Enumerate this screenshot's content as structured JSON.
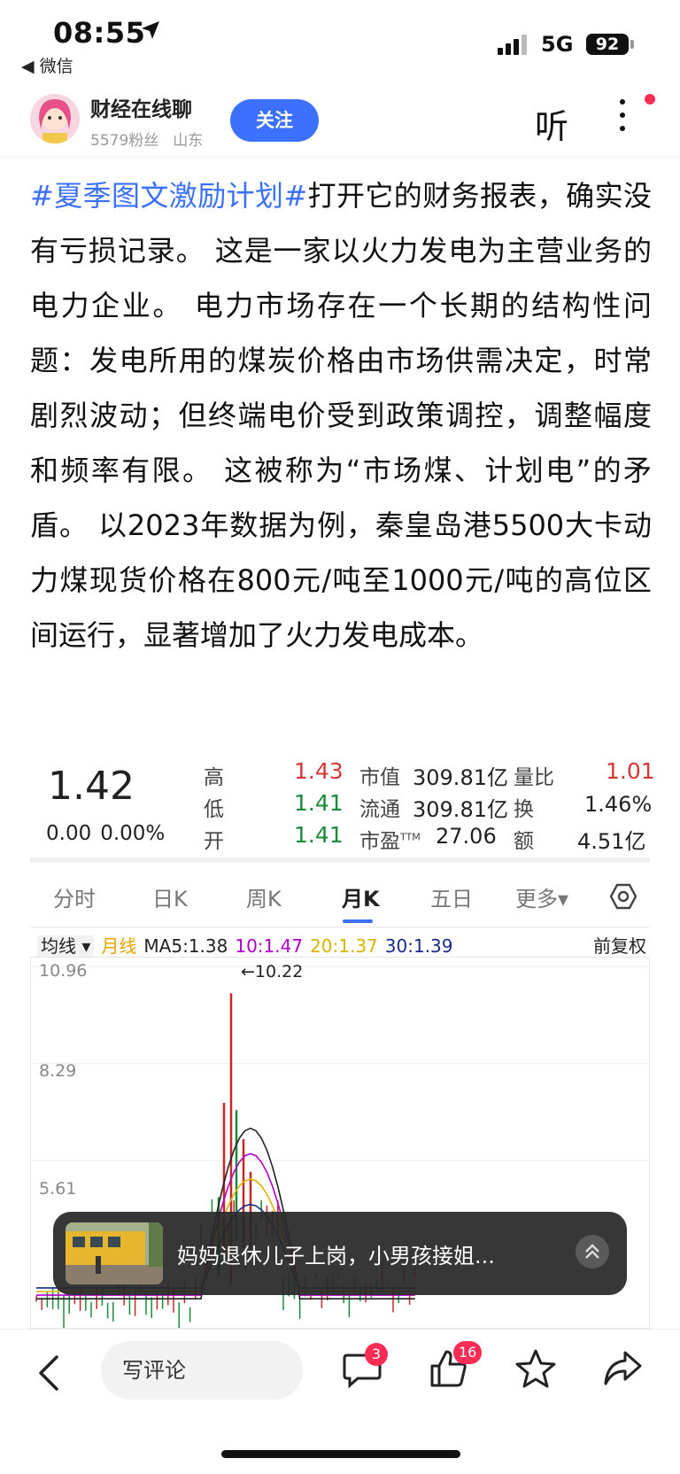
{
  "status_bar": {
    "time": "08:55",
    "back_app": "◀ 微信",
    "network": "5G",
    "battery": "92"
  },
  "author": {
    "name": "财经在线聊",
    "followers": "5579粉丝",
    "location": "山东",
    "follow_label": "关注",
    "listen_label": "听"
  },
  "article": {
    "hashtag": "#夏季图文激励计划#",
    "body": "打开它的财务报表，确实没有亏损记录。 这是一家以火力发电为主营业务的电力企业。 电力市场存在一个长期的结构性问题：发电所用的煤炭价格由市场供需决定，时常剧烈波动；但终端电价受到政策调控，调整幅度和频率有限。 这被称为“市场煤、计划电”的矛盾。 以2023年数据为例，秦皇岛港5500大卡动力煤现货价格在800元/吨至1000元/吨的高位区间运行，显著增加了火力发电成本。"
  },
  "quote": {
    "price": "1.42",
    "change": "0.00",
    "change_pct": "0.00%",
    "high_label": "高",
    "high": "1.43",
    "low_label": "低",
    "low": "1.41",
    "open_label": "开",
    "open": "1.41",
    "mktcap_label": "市值",
    "mktcap": "309.81亿",
    "float_label": "流通",
    "float": "309.81亿",
    "pe_label": "市盈",
    "pe_sup": "TTM",
    "pe": "27.06",
    "vol_ratio_label": "量比",
    "vol_ratio": "1.01",
    "turnover_label": "换",
    "turnover": "1.46%",
    "amount_label": "额",
    "amount": "4.51亿"
  },
  "tabs": [
    "分时",
    "日K",
    "周K",
    "月K",
    "五日",
    "更多▾"
  ],
  "active_tab": "月K",
  "ma_legend": {
    "selector": "均线 ▾",
    "period": "月线",
    "ma5": "MA5:1.38",
    "ma10": "10:1.47",
    "ma20": "20:1.37",
    "ma30": "30:1.39",
    "adjust": "前复权",
    "colors": {
      "period": "#e8a400",
      "ma5": "#222222",
      "ma10": "#b000c8",
      "ma20": "#d8b400",
      "ma30": "#1a2a8a"
    }
  },
  "chart_data": {
    "type": "candlestick",
    "y_labels": [
      "10.96",
      "8.29",
      "5.61"
    ],
    "ylim": [
      1.0,
      10.96
    ],
    "peak_annotation": "←10.22",
    "peak_value": 10.22,
    "up_color": "#c62828",
    "down_color": "#1a8a3a"
  },
  "toast": {
    "text": "妈妈退休儿子上岗，小男孩接姐..."
  },
  "bottom": {
    "comment_placeholder": "写评论",
    "comment_count": "3",
    "like_count": "16"
  }
}
